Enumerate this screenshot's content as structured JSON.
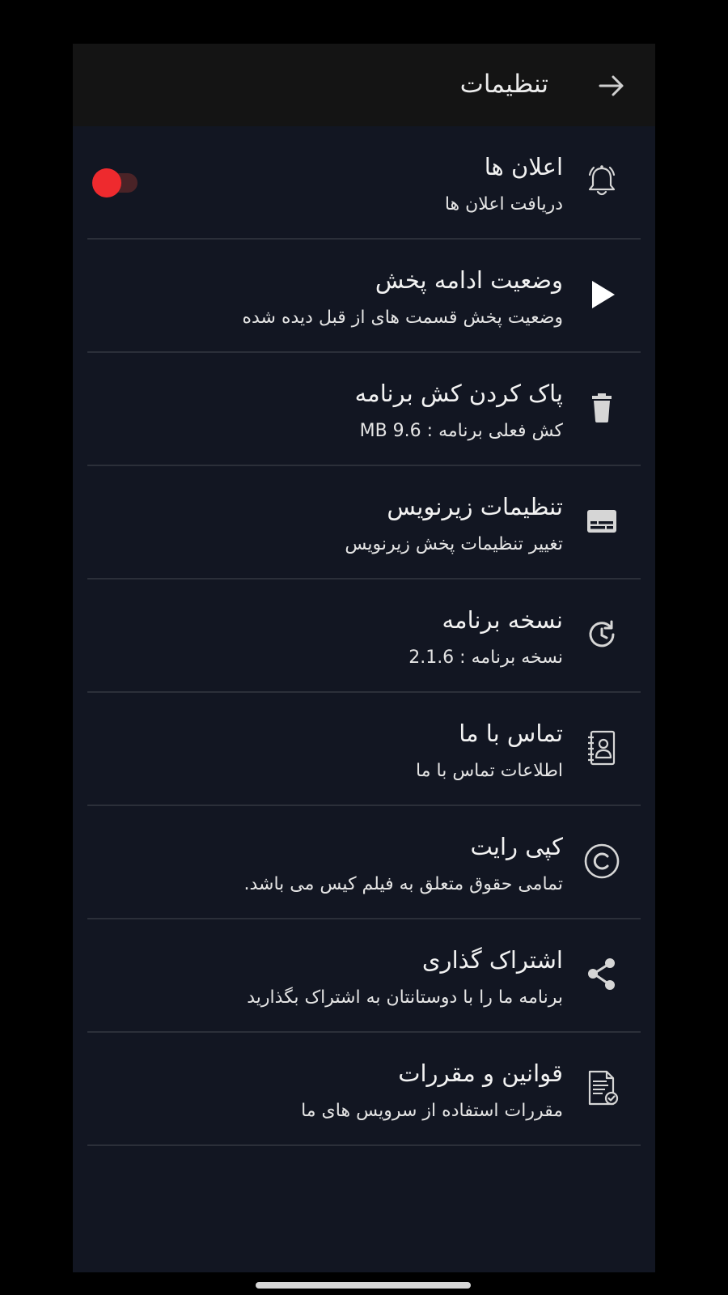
{
  "appbar": {
    "title": "تنظیمات",
    "back_icon": "arrow-right-icon"
  },
  "colors": {
    "background": "#121622",
    "appbar": "#141414",
    "accent": "#ee2a2e",
    "divider": "#2b2f39",
    "text": "#f2f2f2"
  },
  "settings": [
    {
      "id": "notifications",
      "title": "اعلان ها",
      "subtitle": "دریافت اعلان ها",
      "icon": "bell-icon",
      "toggle_on": true
    },
    {
      "id": "resume-playback",
      "title": "وضعیت ادامه پخش",
      "subtitle": "وضعیت پخش قسمت های از قبل دیده شده",
      "icon": "play-icon"
    },
    {
      "id": "clear-cache",
      "title": "پاک کردن کش برنامه",
      "subtitle": "کش فعلی برنامه : MB 9.6",
      "icon": "trash-icon"
    },
    {
      "id": "subtitle-settings",
      "title": "تنظیمات زیرنویس",
      "subtitle": "تغییر تنظیمات پخش زیرنویس",
      "icon": "subtitles-icon"
    },
    {
      "id": "app-version",
      "title": "نسخه برنامه",
      "subtitle": "نسخه برنامه : 2.1.6",
      "icon": "update-icon"
    },
    {
      "id": "contact-us",
      "title": "تماس با ما",
      "subtitle": "اطلاعات تماس با ما",
      "icon": "contact-book-icon"
    },
    {
      "id": "copyright",
      "title": "کپی رایت",
      "subtitle": "تمامی حقوق متعلق به فیلم کیس می باشد.",
      "icon": "copyright-icon"
    },
    {
      "id": "share",
      "title": "اشتراک گذاری",
      "subtitle": "برنامه ما را با دوستانتان به اشتراک بگذارید",
      "icon": "share-icon"
    },
    {
      "id": "terms",
      "title": "قوانین و مقررات",
      "subtitle": "مقررات استفاده از سرویس های ما",
      "icon": "document-check-icon"
    }
  ]
}
